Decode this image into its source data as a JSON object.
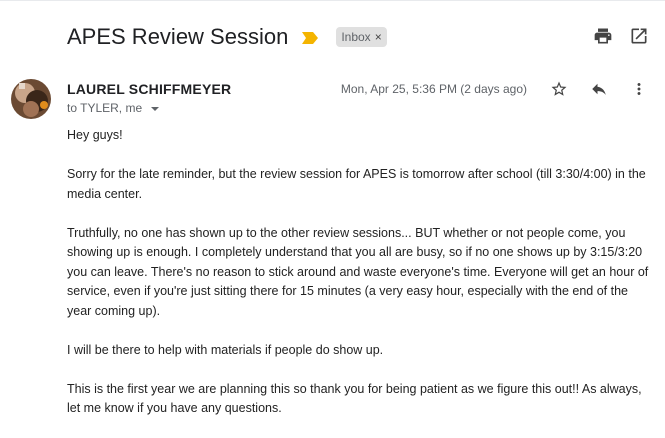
{
  "email": {
    "subject": "APES Review Session",
    "label": "Inbox",
    "label_close": "×",
    "sender": "LAUREL SCHIFFMEYER",
    "recipients": "to TYLER, me",
    "date": "Mon, Apr 25, 5:36 PM (2 days ago)",
    "body": [
      "Hey guys!",
      "Sorry for the late reminder, but the review session for APES is tomorrow after school (till 3:30/4:00) in the media center.",
      "Truthfully, no one has shown up to the other review sessions... BUT whether or not people come, you showing up is enough. I completely understand that you all are busy, so if no one shows up by 3:15/3:20 you can leave. There's no reason to stick around and waste everyone's time. Everyone will get an hour of service, even if you're just sitting there for 15 minutes (a very easy hour, especially with the end of the year coming up).",
      "I will be there to help with materials if people do show up.",
      "This is the first year we are planning this so thank you for being patient as we figure this out!! As always, let me know if you have any questions."
    ]
  },
  "icons": {
    "importance": "importance-marker-icon",
    "print": "print-icon",
    "open_new_window": "open-in-new-window-icon",
    "star": "star-icon",
    "reply": "reply-icon",
    "more": "more-vert-icon",
    "caret": "caret-down-icon"
  },
  "colors": {
    "importance": "#f4b400",
    "label_bg": "#e0e0e0",
    "muted_text": "#5f6368"
  }
}
